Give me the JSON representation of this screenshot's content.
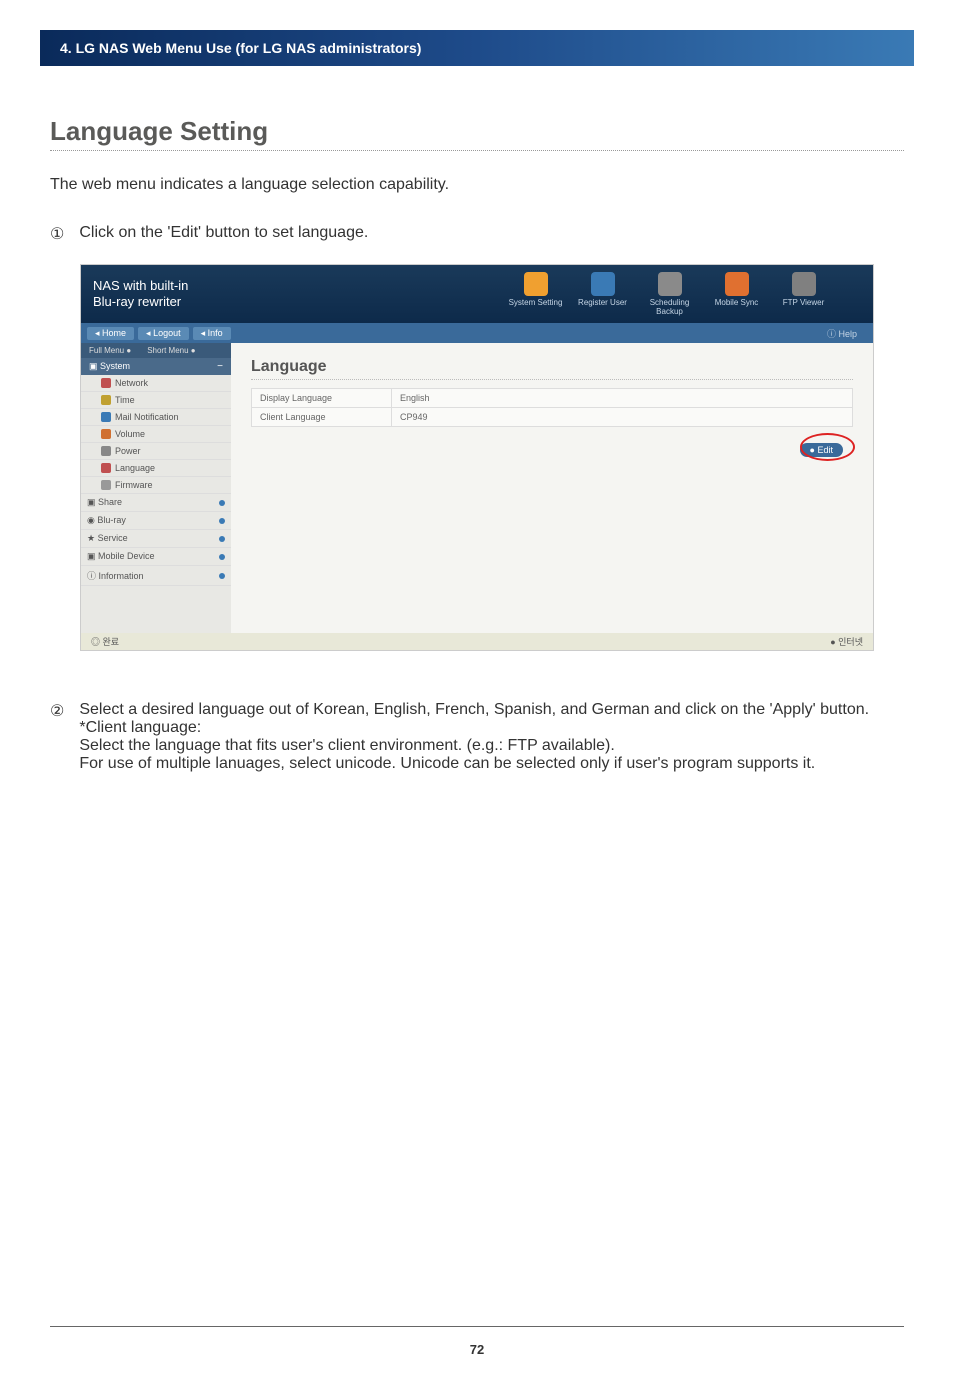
{
  "header": {
    "chapter": "4. LG NAS Web Menu Use (for LG NAS administrators)"
  },
  "section": {
    "title": "Language Setting",
    "intro": "The web menu indicates a language selection capability."
  },
  "steps": [
    {
      "num": "①",
      "text": "Click on the 'Edit' button to set language."
    },
    {
      "num": "②",
      "text": "Select a desired language out of Korean, English, French, Spanish, and German and click on the 'Apply' button."
    }
  ],
  "step2_note_label": "*Client language:",
  "step2_note_line1": "Select the language that fits user's client environment. (e.g.: FTP available).",
  "step2_note_line2": "For use of multiple lanuages, select unicode. Unicode can be selected only if user's program supports it.",
  "screenshot": {
    "logo_line1": "NAS with built-in",
    "logo_line2": "Blu-ray rewriter",
    "topicons": [
      {
        "label": "System Setting",
        "color": "#f0a030"
      },
      {
        "label": "Register User",
        "color": "#3a7ab5"
      },
      {
        "label": "Scheduling Backup",
        "color": "#8a8a8a"
      },
      {
        "label": "Mobile Sync",
        "color": "#e07030"
      },
      {
        "label": "FTP Viewer",
        "color": "#808080"
      }
    ],
    "subbar": [
      "Home",
      "Logout",
      "Info"
    ],
    "help": "Help",
    "tabs": {
      "full": "Full Menu ●",
      "short": "Short Menu ●"
    },
    "system_label": "System",
    "sidebar_sub": [
      {
        "label": "Network",
        "color": "#c05050"
      },
      {
        "label": "Time",
        "color": "#c0a030"
      },
      {
        "label": "Mail Notification",
        "color": "#3a7ab5"
      },
      {
        "label": "Volume",
        "color": "#d07030"
      },
      {
        "label": "Power",
        "color": "#888"
      },
      {
        "label": "Language",
        "color": "#c05050"
      },
      {
        "label": "Firmware",
        "color": "#999"
      }
    ],
    "sidebar_groups": [
      "Share",
      "Blu-ray",
      "Service",
      "Mobile Device",
      "Information"
    ],
    "main_title": "Language",
    "rows": [
      {
        "key": "Display Language",
        "val": "English"
      },
      {
        "key": "Client Language",
        "val": "CP949"
      }
    ],
    "edit_button": "Edit",
    "footer_left": "완료",
    "footer_right": "인터넷"
  },
  "page_number": "72"
}
